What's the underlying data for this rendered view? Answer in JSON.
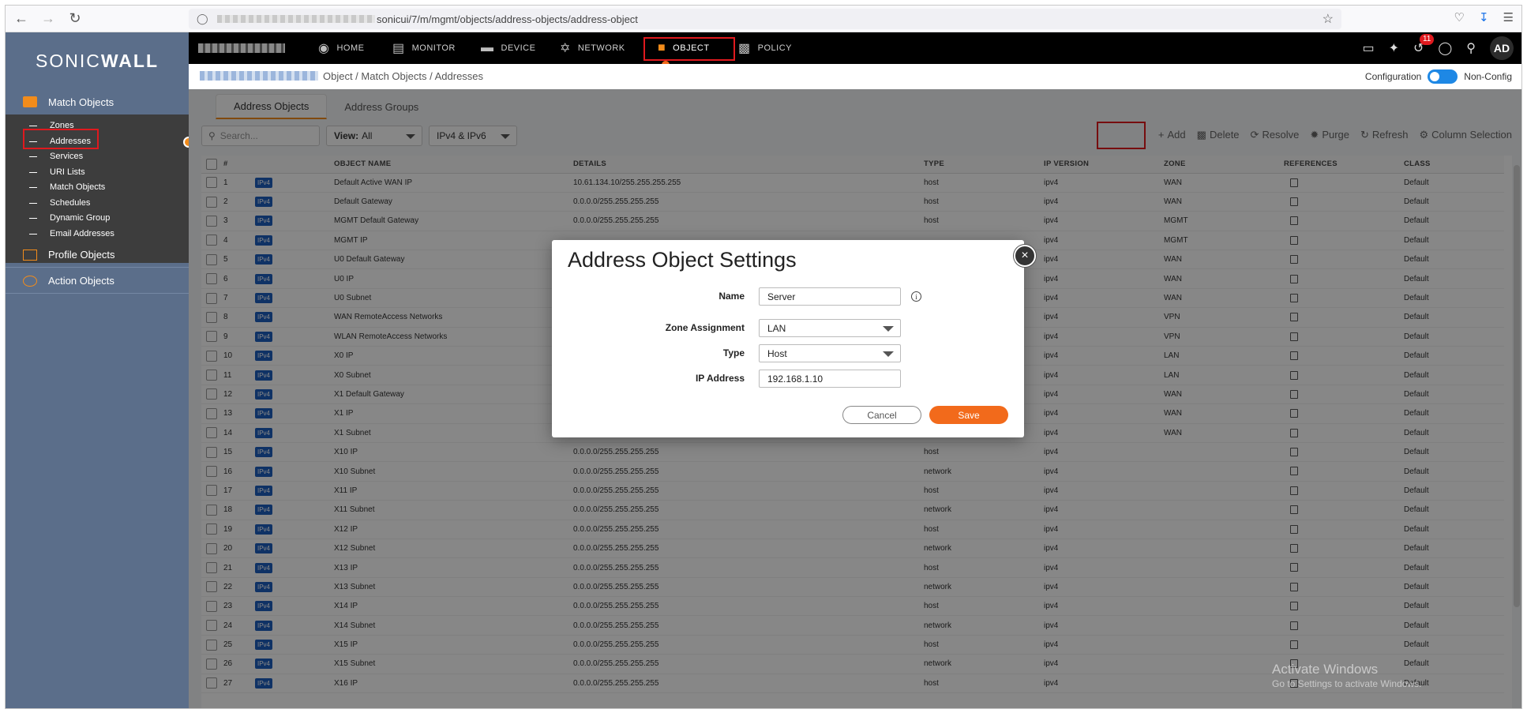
{
  "browser": {
    "url_suffix": "sonicui/7/m/mgmt/objects/address-objects/address-object"
  },
  "brand": {
    "logo_regular": "SONIC",
    "logo_bold": "WALL"
  },
  "topnav": {
    "items": [
      {
        "label": "HOME",
        "icon": "home-icon"
      },
      {
        "label": "MONITOR",
        "icon": "monitor-chart-icon"
      },
      {
        "label": "DEVICE",
        "icon": "device-icon"
      },
      {
        "label": "NETWORK",
        "icon": "network-icon"
      },
      {
        "label": "OBJECT",
        "icon": "object-icon"
      },
      {
        "label": "POLICY",
        "icon": "policy-icon"
      }
    ],
    "active": "OBJECT",
    "notification_count": "11",
    "avatar": "AD"
  },
  "breadcrumb": {
    "text": "Object  /  Match Objects  /  Addresses"
  },
  "config": {
    "left_label": "Configuration",
    "right_label": "Non-Config"
  },
  "sidebar": {
    "match_objects": "Match Objects",
    "items": [
      "Zones",
      "Addresses",
      "Services",
      "URI Lists",
      "Match Objects",
      "Schedules",
      "Dynamic Group",
      "Email Addresses"
    ],
    "active_item": "Addresses",
    "profile_objects": "Profile Objects",
    "action_objects": "Action Objects"
  },
  "tabs": [
    "Address Objects",
    "Address Groups"
  ],
  "toolbar": {
    "search_placeholder": "Search...",
    "view_label": "View:",
    "view_value": "All",
    "ip_filter": "IPv4 & IPv6",
    "actions": [
      "Add",
      "Delete",
      "Resolve",
      "Purge",
      "Refresh",
      "Column Selection"
    ]
  },
  "table": {
    "headers": [
      "#",
      "OBJECT NAME",
      "DETAILS",
      "TYPE",
      "IP VERSION",
      "ZONE",
      "REFERENCES",
      "CLASS"
    ],
    "tag": "IPv4",
    "rows": [
      [
        "1",
        "Default Active WAN IP",
        "10.61.134.10/255.255.255.255",
        "host",
        "ipv4",
        "WAN",
        "Default"
      ],
      [
        "2",
        "Default Gateway",
        "0.0.0.0/255.255.255.255",
        "host",
        "ipv4",
        "WAN",
        "Default"
      ],
      [
        "3",
        "MGMT Default Gateway",
        "0.0.0.0/255.255.255.255",
        "host",
        "ipv4",
        "MGMT",
        "Default"
      ],
      [
        "4",
        "MGMT IP",
        "",
        "",
        "ipv4",
        "MGMT",
        "Default"
      ],
      [
        "5",
        "U0 Default Gateway",
        "",
        "",
        "ipv4",
        "WAN",
        "Default"
      ],
      [
        "6",
        "U0 IP",
        "",
        "",
        "ipv4",
        "WAN",
        "Default"
      ],
      [
        "7",
        "U0 Subnet",
        "",
        "",
        "ipv4",
        "WAN",
        "Default"
      ],
      [
        "8",
        "WAN RemoteAccess Networks",
        "",
        "",
        "ipv4",
        "VPN",
        "Default"
      ],
      [
        "9",
        "WLAN RemoteAccess Networks",
        "",
        "",
        "ipv4",
        "VPN",
        "Default"
      ],
      [
        "10",
        "X0 IP",
        "",
        "",
        "ipv4",
        "LAN",
        "Default"
      ],
      [
        "11",
        "X0 Subnet",
        "",
        "",
        "ipv4",
        "LAN",
        "Default"
      ],
      [
        "12",
        "X1 Default Gateway",
        "",
        "",
        "ipv4",
        "WAN",
        "Default"
      ],
      [
        "13",
        "X1 IP",
        "",
        "",
        "ipv4",
        "WAN",
        "Default"
      ],
      [
        "14",
        "X1 Subnet",
        "",
        "",
        "ipv4",
        "WAN",
        "Default"
      ],
      [
        "15",
        "X10 IP",
        "0.0.0.0/255.255.255.255",
        "host",
        "ipv4",
        "",
        "Default"
      ],
      [
        "16",
        "X10 Subnet",
        "0.0.0.0/255.255.255.255",
        "network",
        "ipv4",
        "",
        "Default"
      ],
      [
        "17",
        "X11 IP",
        "0.0.0.0/255.255.255.255",
        "host",
        "ipv4",
        "",
        "Default"
      ],
      [
        "18",
        "X11 Subnet",
        "0.0.0.0/255.255.255.255",
        "network",
        "ipv4",
        "",
        "Default"
      ],
      [
        "19",
        "X12 IP",
        "0.0.0.0/255.255.255.255",
        "host",
        "ipv4",
        "",
        "Default"
      ],
      [
        "20",
        "X12 Subnet",
        "0.0.0.0/255.255.255.255",
        "network",
        "ipv4",
        "",
        "Default"
      ],
      [
        "21",
        "X13 IP",
        "0.0.0.0/255.255.255.255",
        "host",
        "ipv4",
        "",
        "Default"
      ],
      [
        "22",
        "X13 Subnet",
        "0.0.0.0/255.255.255.255",
        "network",
        "ipv4",
        "",
        "Default"
      ],
      [
        "23",
        "X14 IP",
        "0.0.0.0/255.255.255.255",
        "host",
        "ipv4",
        "",
        "Default"
      ],
      [
        "24",
        "X14 Subnet",
        "0.0.0.0/255.255.255.255",
        "network",
        "ipv4",
        "",
        "Default"
      ],
      [
        "25",
        "X15 IP",
        "0.0.0.0/255.255.255.255",
        "host",
        "ipv4",
        "",
        "Default"
      ],
      [
        "26",
        "X15 Subnet",
        "0.0.0.0/255.255.255.255",
        "network",
        "ipv4",
        "",
        "Default"
      ],
      [
        "27",
        "X16 IP",
        "0.0.0.0/255.255.255.255",
        "host",
        "ipv4",
        "",
        "Default"
      ]
    ]
  },
  "modal": {
    "title": "Address Object Settings",
    "name_label": "Name",
    "name_value": "Server",
    "zone_label": "Zone Assignment",
    "zone_value": "LAN",
    "type_label": "Type",
    "type_value": "Host",
    "ip_label": "IP Address",
    "ip_value": "192.168.1.10",
    "cancel": "Cancel",
    "save": "Save"
  },
  "watermark": {
    "line1": "Activate Windows",
    "line2": "Go to Settings to activate Windows."
  },
  "colors": {
    "accent": "#f26a1b",
    "highlight": "#e0191e",
    "sidebar": "#5b6e8a",
    "topnav": "#000000"
  }
}
